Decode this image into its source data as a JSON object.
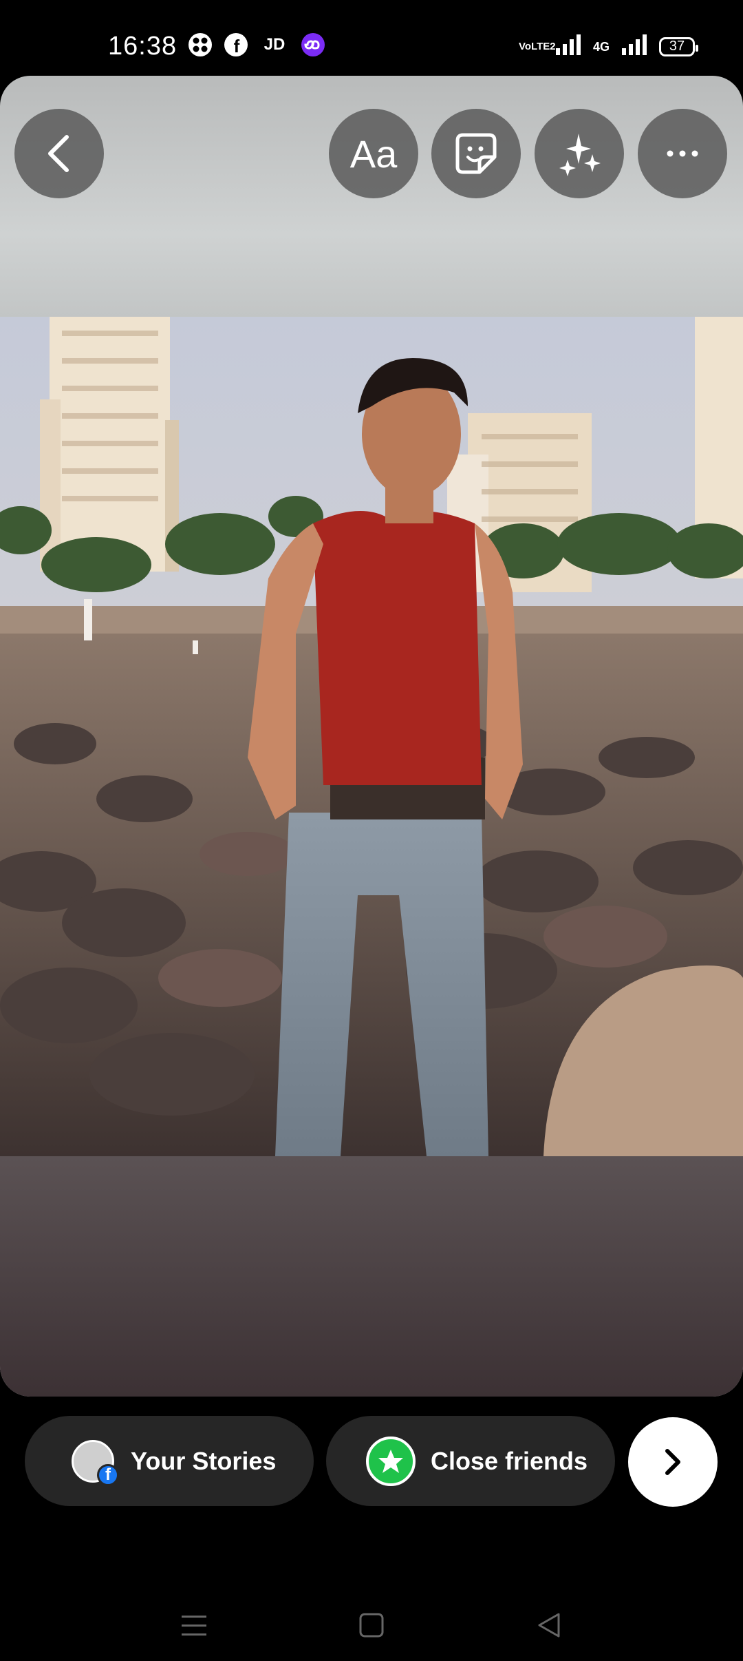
{
  "status_bar": {
    "time": "16:38",
    "left_icons": [
      "app-icon",
      "facebook-icon",
      "jd-icon",
      "link-icon"
    ],
    "jd_label": "JD",
    "network_label_1": "VoLTE2",
    "network_label_2": "4G",
    "battery": "37"
  },
  "toolbar": {
    "back_icon": "chevron-left-icon",
    "text_label": "Aa",
    "sticker_icon": "sticker-icon",
    "effects_icon": "sparkles-icon",
    "more_icon": "more-icon"
  },
  "story": {
    "photo_subject": "image"
  },
  "share": {
    "your_stories_label": "Your Stories",
    "close_friends_label": "Close friends",
    "next_icon": "chevron-right-icon"
  },
  "colors": {
    "close_friends_green": "#1fc24a",
    "facebook_blue": "#1877f2",
    "pill_bg": "#262626"
  }
}
